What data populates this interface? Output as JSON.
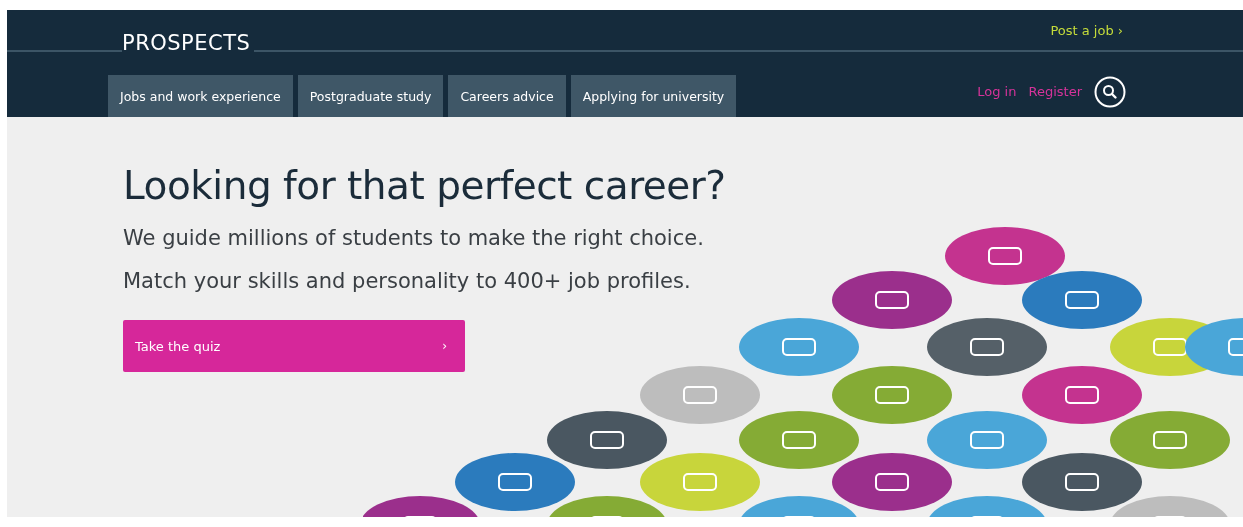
{
  "header": {
    "logo": "PROSPECTS",
    "post_job": "Post a job ›",
    "nav_tabs": [
      {
        "label": "Jobs and work experience"
      },
      {
        "label": "Postgraduate study"
      },
      {
        "label": "Careers advice"
      },
      {
        "label": "Applying for university"
      }
    ],
    "account_links": [
      "Log in",
      "Register"
    ]
  },
  "hero": {
    "heading": "Looking for that perfect career?",
    "lines": [
      "We guide millions of students to make the right choice.",
      "Match your skills and personality to 400+ job profiles."
    ],
    "button": {
      "label": "Take the quiz",
      "arrow": "›"
    }
  }
}
